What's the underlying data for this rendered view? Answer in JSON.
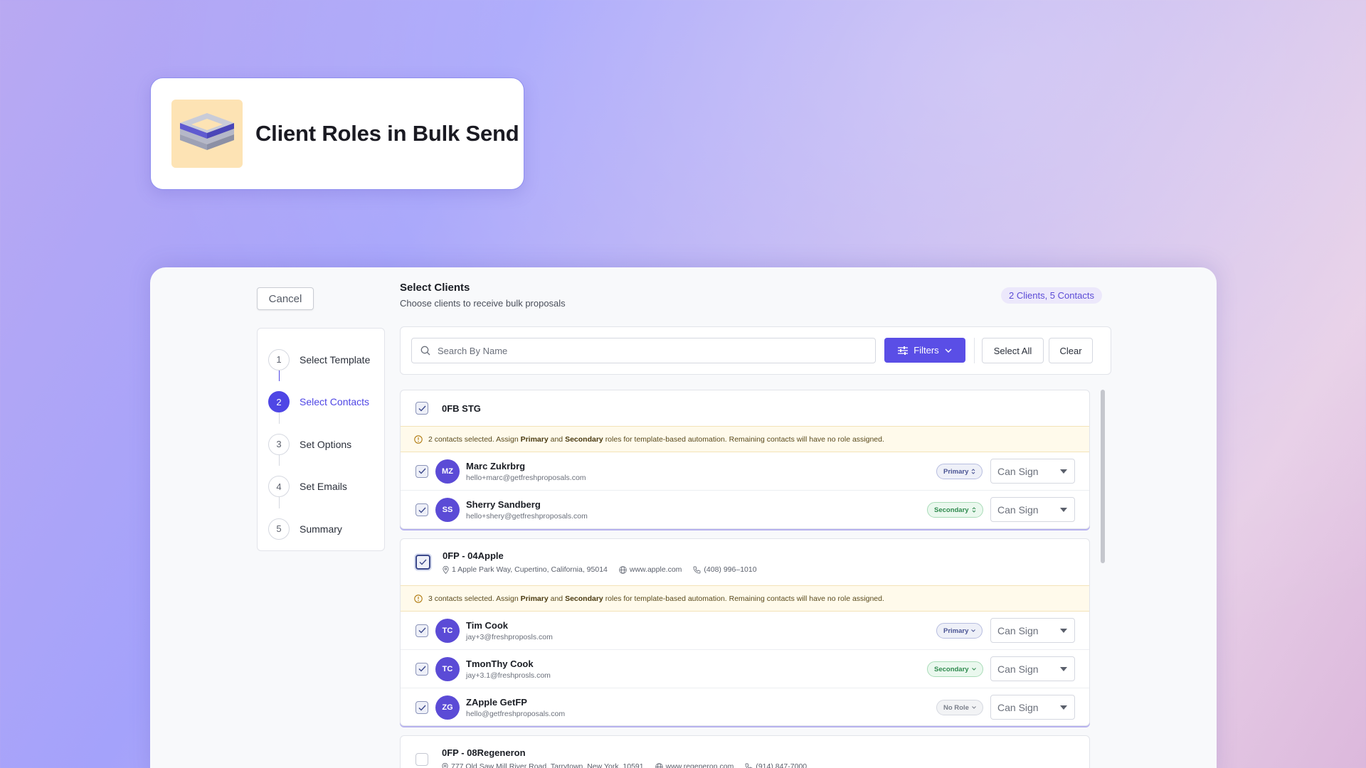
{
  "title_card": {
    "title": "Client Roles in Bulk Send"
  },
  "cancel_label": "Cancel",
  "steps": [
    {
      "num": "1",
      "label": "Select Template"
    },
    {
      "num": "2",
      "label": "Select Contacts"
    },
    {
      "num": "3",
      "label": "Set Options"
    },
    {
      "num": "4",
      "label": "Set Emails"
    },
    {
      "num": "5",
      "label": "Summary"
    }
  ],
  "main": {
    "title": "Select Clients",
    "subtitle": "Choose clients to receive bulk proposals",
    "count": "2 Clients, 5 Contacts"
  },
  "toolbar": {
    "search_placeholder": "Search By Name",
    "filters_label": "Filters",
    "select_all_label": "Select All",
    "clear_label": "Clear"
  },
  "groups": [
    {
      "name": "0FB STG",
      "notice": {
        "count_text": "2 contacts selected. Assign",
        "primary": "Primary",
        "and": "and",
        "secondary": "Secondary",
        "tail": "roles for template-based automation. Remaining contacts will have no role assigned."
      },
      "contacts": [
        {
          "initials": "MZ",
          "name": "Marc Zukrbrg",
          "email": "hello+marc@getfreshproposals.com",
          "role": "Primary",
          "permission": "Can Sign"
        },
        {
          "initials": "SS",
          "name": "Sherry Sandberg",
          "email": "hello+shery@getfreshproposals.com",
          "role": "Secondary",
          "permission": "Can Sign"
        }
      ]
    },
    {
      "name": "0FP - 04Apple",
      "address": "1 Apple Park Way, Cupertino, California, 95014",
      "website": "www.apple.com",
      "phone": "(408) 996–1010",
      "notice": {
        "count_text": "3 contacts selected. Assign",
        "primary": "Primary",
        "and": "and",
        "secondary": "Secondary",
        "tail": "roles for template-based automation. Remaining contacts will have no role assigned."
      },
      "contacts": [
        {
          "initials": "TC",
          "name": "Tim Cook",
          "email": "jay+3@freshproposls.com",
          "role": "Primary",
          "permission": "Can Sign"
        },
        {
          "initials": "TC",
          "name": "TmonThy Cook",
          "email": "jay+3.1@freshprosls.com",
          "role": "Secondary",
          "permission": "Can Sign"
        },
        {
          "initials": "ZG",
          "name": "ZApple GetFP",
          "email": "hello@getfreshproposals.com",
          "role": "No Role",
          "permission": "Can Sign"
        }
      ]
    },
    {
      "name": "0FP - 08Regeneron",
      "address": "777 Old Saw Mill River Road, Tarrytown, New York, 10591",
      "website": "www.regeneron.com",
      "phone": "(914) 847-7000"
    }
  ],
  "colors": {
    "accent": "#5a4ee6",
    "primary_pill": "#4a5494",
    "secondary_pill": "#2f8a4e",
    "notice_bg": "#fffaeb"
  }
}
